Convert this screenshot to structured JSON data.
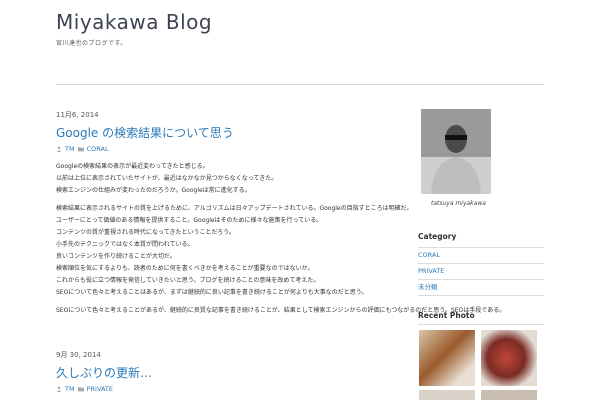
{
  "header": {
    "site_title": "Miyakawa Blog",
    "site_description": "宮川達也のブログです。"
  },
  "posts": [
    {
      "date": "11月6, 2014",
      "title": "Google の検索結果について思う",
      "author": "TM",
      "category": "CORAL",
      "paragraphs": [
        "Googleの検索結果の表示が最近変わってきたと感じる。",
        "以前は上位に表示されていたサイトが、最近はなかなか見つからなくなってきた。",
        "検索エンジンの仕組みが変わったのだろうか。Googleは常に進化する。",
        "検索結果に表示されるサイトの質を上げるために、アルゴリズムは日々アップデートされている。Googleの目指すところは明確だ。",
        "ユーザーにとって価値のある情報を提供すること。Googleはそのために様々な施策を行っている。",
        "コンテンツの質が重視される時代になってきたということだろう。",
        "小手先のテクニックではなく本質が問われている。",
        "良いコンテンツを作り続けることが大切だ。",
        "検索順位を気にするよりも、読者のために何を書くべきかを考えることが重要なのではないか。",
        "これからも役に立つ情報を発信していきたいと思う。ブログを続けることの意味を改めて考えた。",
        "SEOについて色々と考えることはあるが、まずは継続的に良い記事を書き続けることが何よりも大事なのだと思う。",
        "SEOについて色々と考えることがあるが、継続的に良質な記事を書き続けることが、結果として検索エンジンからの評価にもつながるのだと思う。SEOは手段である。"
      ]
    },
    {
      "date": "9月 30, 2014",
      "title": "久しぶりの更新…",
      "author": "TM",
      "category": "PRIVATE"
    }
  ],
  "sidebar": {
    "profile_caption": "tatsuya miyakawa",
    "category_title": "Category",
    "categories": [
      "CORAL",
      "PRIVATE",
      "未分類"
    ],
    "recent_photo_title": "Recent Photo"
  },
  "colors": {
    "link": "#2a7ab8",
    "title": "#3d4453",
    "rule": "#dcdcdc"
  }
}
